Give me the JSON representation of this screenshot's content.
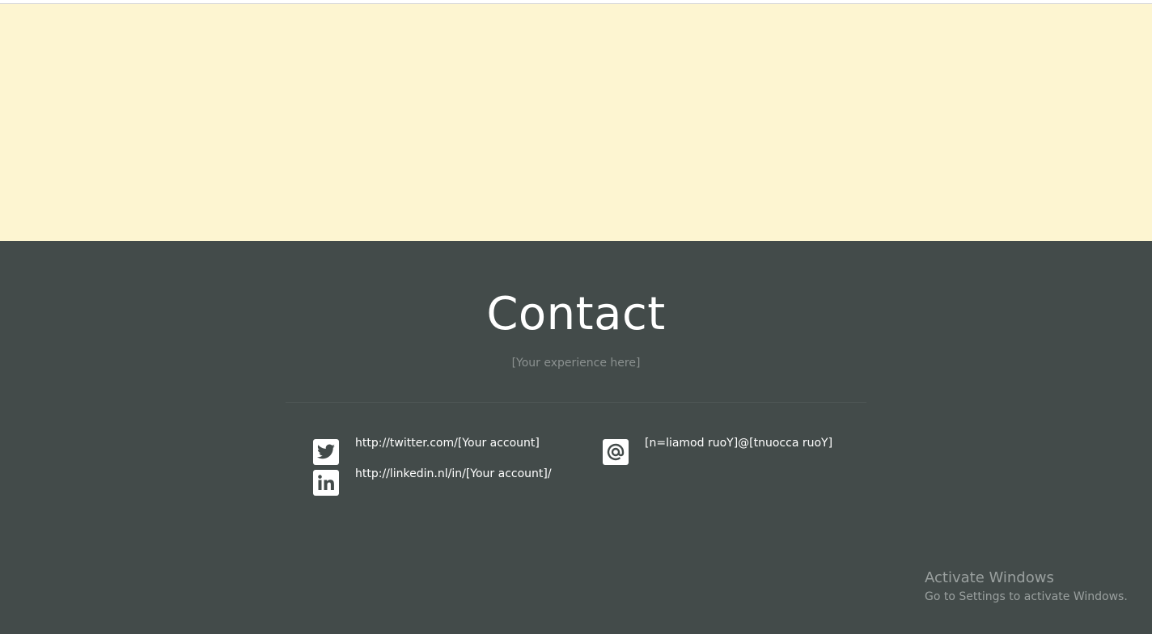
{
  "contact": {
    "title": "Contact",
    "subtitle": "[Your experience here]",
    "links": {
      "twitter": {
        "icon": "twitter-icon",
        "text": "http://twitter.com/[Your account]"
      },
      "linkedin": {
        "icon": "linkedin-icon",
        "text": "http://linkedin.nl/in/[Your account]/"
      },
      "email": {
        "icon": "at-sign-icon",
        "text": "[n=liamod ruoY]@[tnuocca ruoY]"
      }
    }
  },
  "watermark": {
    "title": "Activate Windows",
    "subtitle": "Go to Settings to activate Windows."
  },
  "colors": {
    "hero_background": "#fdf5d1",
    "contact_background": "#434b4a",
    "text_primary": "#ffffff",
    "text_muted": "#8b9190"
  }
}
